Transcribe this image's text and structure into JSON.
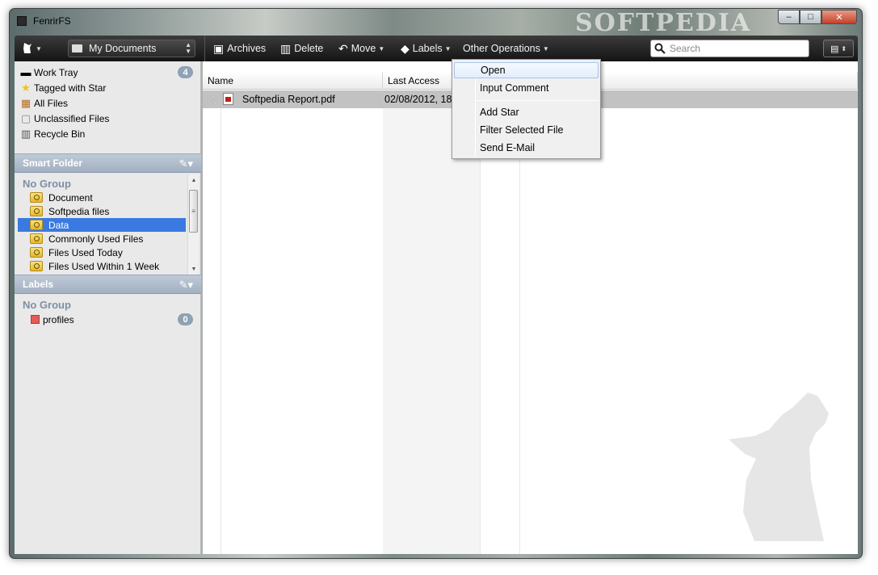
{
  "window": {
    "title": "FenrirFS",
    "watermark": "SOFTPEDIA",
    "buttons": {
      "minimize": "–",
      "maximize": "□",
      "close": "✕"
    }
  },
  "toolbar": {
    "location": "My Documents",
    "items": {
      "archives": "Archives",
      "delete": "Delete",
      "move": "Move",
      "labels": "Labels",
      "other_operations": "Other Operations"
    },
    "search_placeholder": "Search"
  },
  "sidebar": {
    "nav": [
      {
        "label": "Work Tray",
        "icon": "work-tray-icon",
        "badge": "4"
      },
      {
        "label": "Tagged with Star",
        "icon": "star-icon"
      },
      {
        "label": "All Files",
        "icon": "all-files-icon"
      },
      {
        "label": "Unclassified Files",
        "icon": "unclassified-icon"
      },
      {
        "label": "Recycle Bin",
        "icon": "recycle-bin-icon"
      }
    ],
    "smart_folder": {
      "header": "Smart Folder",
      "group": "No Group",
      "items": [
        "Document",
        "Softpedia files",
        "Data",
        "Commonly Used Files",
        "Files Used Today",
        "Files Used Within 1 Week"
      ],
      "selected": "Data"
    },
    "labels": {
      "header": "Labels",
      "group": "No Group",
      "items": [
        {
          "label": "profiles",
          "color": "#e65a55",
          "count": "0"
        }
      ]
    }
  },
  "file_list": {
    "columns": {
      "name": "Name",
      "last_access": "Last Access"
    },
    "rows": [
      {
        "name": "Softpedia Report.pdf",
        "last_access": "02/08/2012, 18:3"
      }
    ]
  },
  "context_menu": {
    "items": {
      "open": "Open",
      "input_comment": "Input Comment",
      "add_star": "Add Star",
      "filter_selected_file": "Filter Selected File",
      "send_email": "Send E-Mail"
    },
    "highlighted": "Open"
  },
  "colors": {
    "toolbar": "#1e1e1e",
    "selection": "#3a7ae0",
    "section_header": "#a2b0c2",
    "badge": "#8fa1b4"
  }
}
